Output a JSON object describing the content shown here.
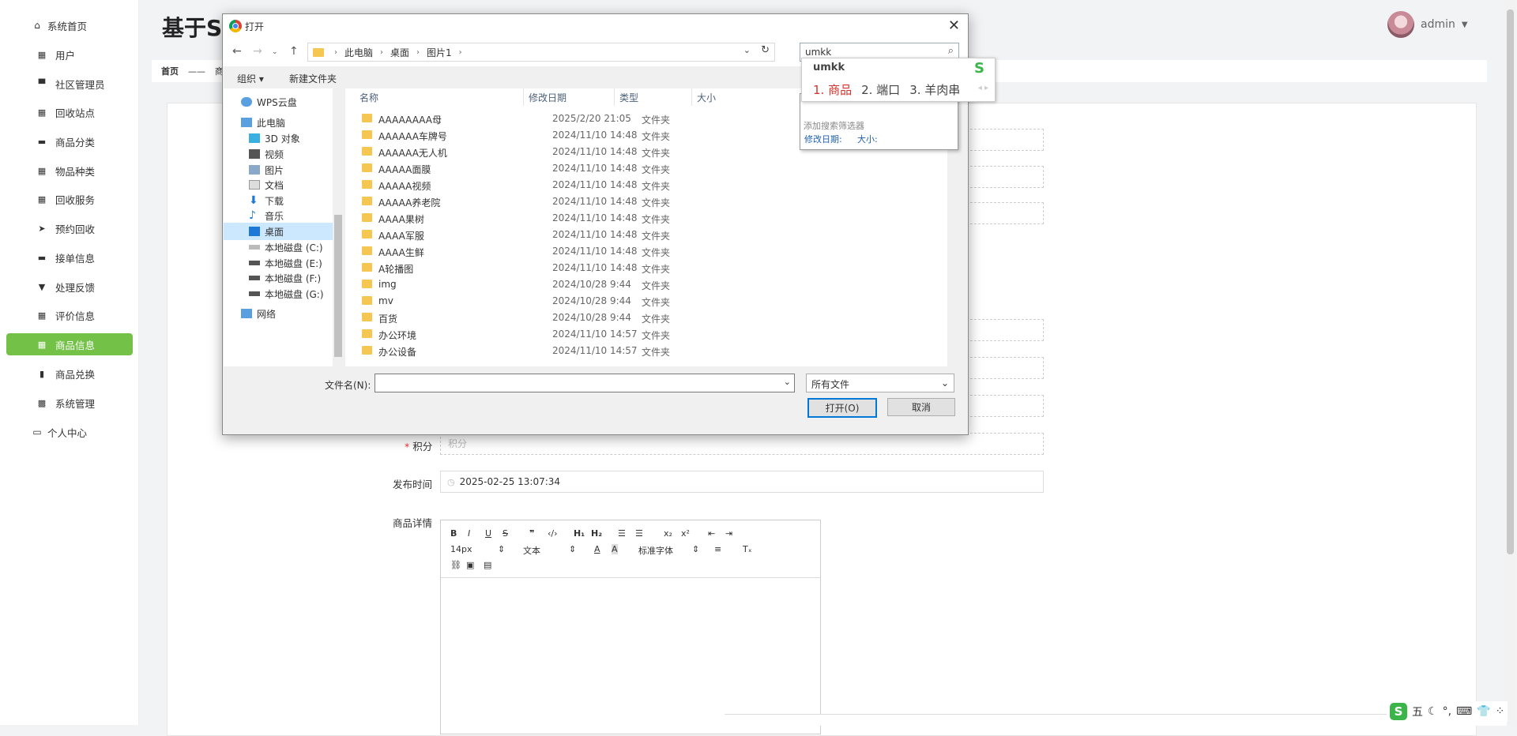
{
  "app": {
    "title": "基于S",
    "user": "admin",
    "breadcrumb": [
      "首页",
      "——",
      "商"
    ]
  },
  "sidebar": {
    "items": [
      {
        "label": "系统首页",
        "icon": "home-icon"
      },
      {
        "label": "用户",
        "icon": "grid-icon"
      },
      {
        "label": "社区管理员",
        "icon": "user-icon"
      },
      {
        "label": "回收站点",
        "icon": "grid-icon"
      },
      {
        "label": "商品分类",
        "icon": "bag-icon"
      },
      {
        "label": "物品种类",
        "icon": "grid-icon"
      },
      {
        "label": "回收服务",
        "icon": "grid-icon"
      },
      {
        "label": "预约回收",
        "icon": "send-icon"
      },
      {
        "label": "接单信息",
        "icon": "ticket-icon"
      },
      {
        "label": "处理反馈",
        "icon": "cup-icon"
      },
      {
        "label": "评价信息",
        "icon": "grid-icon"
      },
      {
        "label": "商品信息",
        "icon": "grid-icon",
        "active": true
      },
      {
        "label": "商品兑换",
        "icon": "clipboard-icon"
      },
      {
        "label": "系统管理",
        "icon": "apps-icon"
      },
      {
        "label": "个人中心",
        "icon": "profile-icon"
      }
    ]
  },
  "form": {
    "points_label": "积分",
    "points_placeholder": "积分",
    "publish_time_label": "发布时间",
    "publish_time_value": "2025-02-25 13:07:34",
    "details_label": "商品详情",
    "editor": {
      "font_size": "14px",
      "text_style": "文本",
      "font_family": "标准字体"
    }
  },
  "dialog": {
    "title": "打开",
    "path": [
      "此电脑",
      "桌面",
      "图片1"
    ],
    "search_value": "umkk",
    "organize": "组织 ▾",
    "new_folder": "新建文件夹",
    "nav_items": [
      {
        "label": "WPS云盘"
      },
      {
        "label": "此电脑"
      },
      {
        "label": "3D 对象"
      },
      {
        "label": "视频"
      },
      {
        "label": "图片"
      },
      {
        "label": "文档"
      },
      {
        "label": "下载"
      },
      {
        "label": "音乐"
      },
      {
        "label": "桌面",
        "selected": true
      },
      {
        "label": "本地磁盘 (C:)"
      },
      {
        "label": "本地磁盘 (E:)"
      },
      {
        "label": "本地磁盘 (F:)"
      },
      {
        "label": "本地磁盘 (G:)"
      },
      {
        "label": "网络"
      }
    ],
    "columns": [
      "名称",
      "修改日期",
      "类型",
      "大小"
    ],
    "files": [
      {
        "name": "AAAAAAAA母",
        "date": "2025/2/20 21:05",
        "type": "文件夹"
      },
      {
        "name": "AAAAAA车牌号",
        "date": "2024/11/10 14:48",
        "type": "文件夹"
      },
      {
        "name": "AAAAAA无人机",
        "date": "2024/11/10 14:48",
        "type": "文件夹"
      },
      {
        "name": "AAAAA面膜",
        "date": "2024/11/10 14:48",
        "type": "文件夹"
      },
      {
        "name": "AAAAA视频",
        "date": "2024/11/10 14:48",
        "type": "文件夹"
      },
      {
        "name": "AAAAA养老院",
        "date": "2024/11/10 14:48",
        "type": "文件夹"
      },
      {
        "name": "AAAA果树",
        "date": "2024/11/10 14:48",
        "type": "文件夹"
      },
      {
        "name": "AAAA军服",
        "date": "2024/11/10 14:48",
        "type": "文件夹"
      },
      {
        "name": "AAAA生鲜",
        "date": "2024/11/10 14:48",
        "type": "文件夹"
      },
      {
        "name": "A轮播图",
        "date": "2024/11/10 14:48",
        "type": "文件夹"
      },
      {
        "name": "img",
        "date": "2024/10/28 9:44",
        "type": "文件夹"
      },
      {
        "name": "mv",
        "date": "2024/10/28 9:44",
        "type": "文件夹"
      },
      {
        "name": "百货",
        "date": "2024/10/28 9:44",
        "type": "文件夹"
      },
      {
        "name": "办公环境",
        "date": "2024/11/10 14:57",
        "type": "文件夹"
      },
      {
        "name": "办公设备",
        "date": "2024/11/10 14:57",
        "type": "文件夹"
      }
    ],
    "filename_label": "文件名(N):",
    "filename_value": "",
    "filetype": "所有文件",
    "open_button": "打开(O)",
    "cancel_button": "取消",
    "search_suggest": {
      "filter_title": "添加搜索筛选器",
      "filter_date": "修改日期:",
      "filter_size": "大小:"
    }
  },
  "ime": {
    "composition": "umkk",
    "candidates": [
      "1. 商品",
      "2. 端口",
      "3. 羊肉串"
    ],
    "tray": [
      "五",
      "☾",
      "°,",
      "⌨",
      "👕",
      "⁘"
    ]
  }
}
